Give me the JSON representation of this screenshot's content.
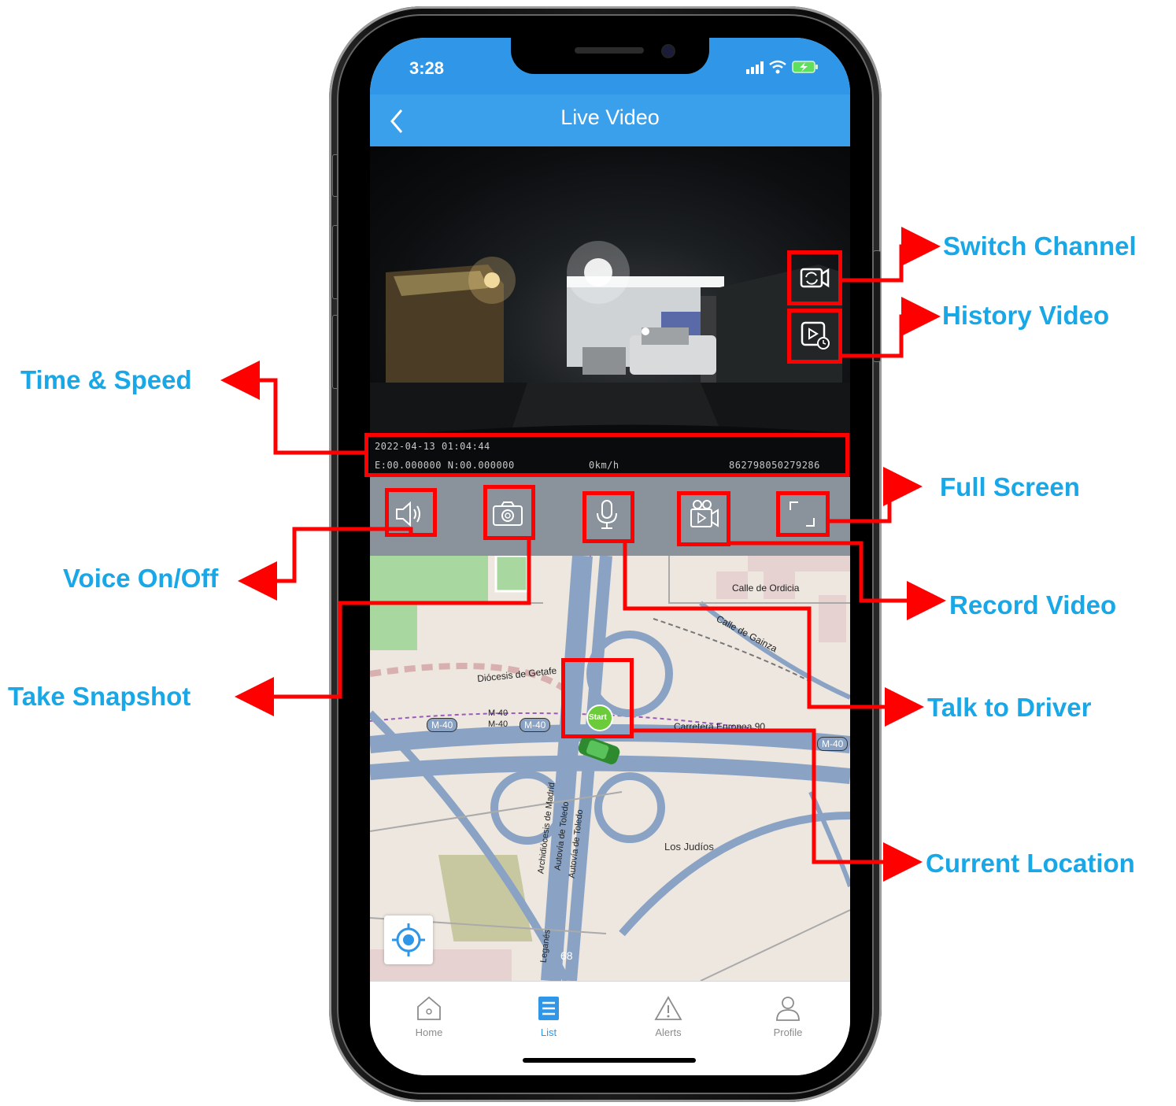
{
  "status_bar": {
    "time": "3:28"
  },
  "header": {
    "title": "Live Video"
  },
  "video_osd": {
    "datetime": "2022-04-13 01:04:44",
    "coordinates": "E:00.000000 N:00.000000",
    "speed": "0km/h",
    "device_id": "862798050279286"
  },
  "controls": [
    "voice-icon",
    "camera-icon",
    "microphone-icon",
    "video-record-icon",
    "fullscreen-icon"
  ],
  "video_overlay_buttons": [
    "switch-channel-icon",
    "history-video-icon"
  ],
  "map": {
    "labels": {
      "calle_ordicia": "Calle de Ordicia",
      "calle_gainza": "Calle de Gainza",
      "diocesis": "Diócesis de Getafe",
      "carretera": "Carretera Europea 90",
      "m40_a": "M-40",
      "m40_b": "M-40",
      "m40_c": "M-40",
      "m40_d": "M-40",
      "m40_small": "M-40",
      "los_judios": "Los Judíos",
      "autovia_1": "Autovía de Toledo",
      "autovia_2": "Autovía de Toledo",
      "arch": "Archidiócesis de Madrid",
      "leganes": "Leganés",
      "road_num": "68",
      "start": "Start"
    }
  },
  "tab_bar": {
    "home": "Home",
    "list": "List",
    "alerts": "Alerts",
    "profile": "Profile"
  },
  "annotations": {
    "switch_channel": "Switch Channel",
    "history_video": "History Video",
    "time_speed": "Time & Speed",
    "full_screen": "Full Screen",
    "voice": "Voice On/Off",
    "record_video": "Record Video",
    "take_snapshot": "Take Snapshot",
    "talk_to_driver": "Talk to Driver",
    "current_location": "Current Location"
  },
  "colors": {
    "accent_blue": "#2f96e8",
    "annotation_red": "#ff0000",
    "annotation_text": "#18a8e8",
    "road_blue": "#8aa3c4"
  }
}
